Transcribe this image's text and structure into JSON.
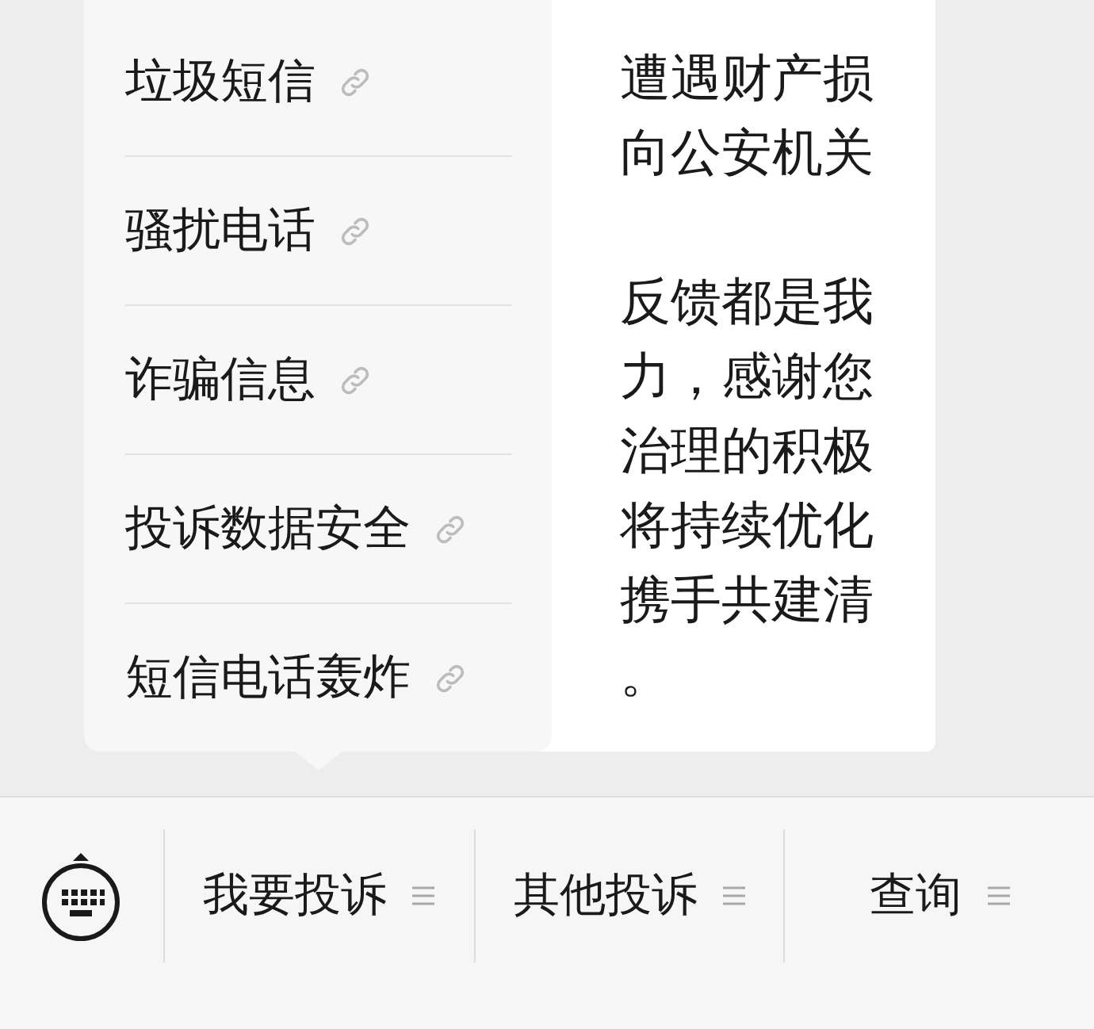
{
  "message": {
    "paragraphs": [
      [
        "遭遇财产损",
        "向公安机关"
      ],
      [
        "反馈都是我",
        "力，感谢您",
        "治理的积极",
        "将持续优化",
        "携手共建清",
        "。"
      ]
    ]
  },
  "popup_menu": {
    "items": [
      {
        "label": "垃圾短信"
      },
      {
        "label": "骚扰电话"
      },
      {
        "label": "诈骗信息"
      },
      {
        "label": "投诉数据安全"
      },
      {
        "label": "短信电话轰炸"
      }
    ]
  },
  "bottom_menu": {
    "items": [
      {
        "label": "我要投诉"
      },
      {
        "label": "其他投诉"
      },
      {
        "label": "查询"
      }
    ]
  }
}
